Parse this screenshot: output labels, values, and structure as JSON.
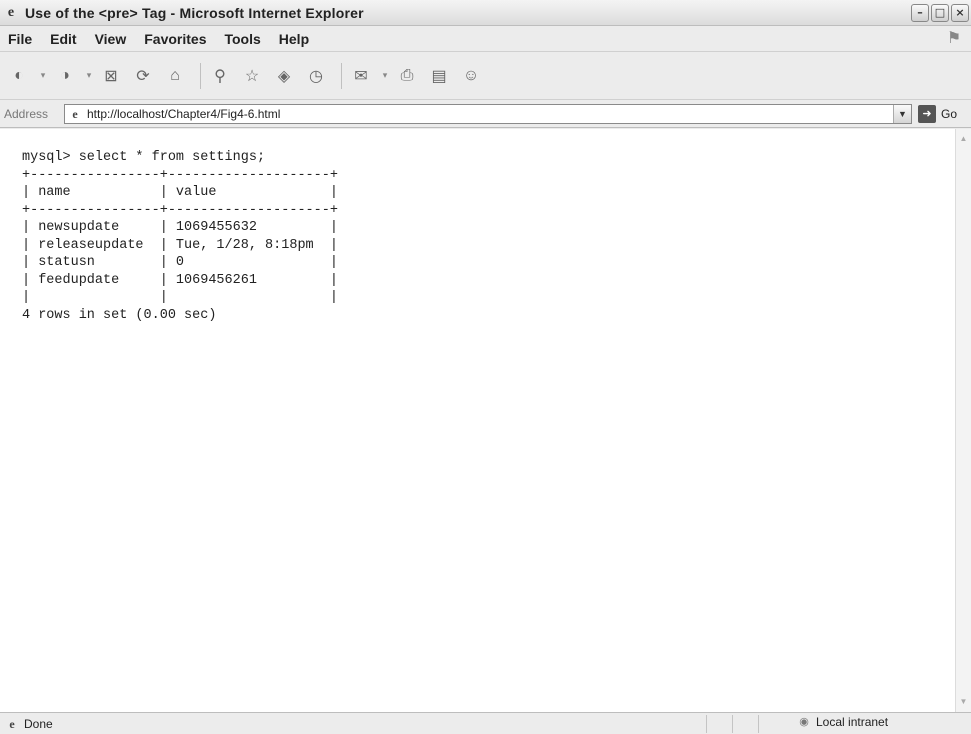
{
  "window": {
    "title": "Use of the <pre> Tag - Microsoft Internet Explorer",
    "controls": [
      "minimize-icon",
      "maximize-icon",
      "close-icon"
    ]
  },
  "menu": {
    "items": [
      "File",
      "Edit",
      "View",
      "Favorites",
      "Tools",
      "Help"
    ]
  },
  "toolbar": {
    "icons": [
      "back-icon",
      "forward-icon",
      "stop-icon",
      "refresh-icon",
      "home-icon",
      "search-icon",
      "favorites-icon",
      "media-icon",
      "history-icon",
      "mail-icon",
      "print-icon",
      "edit-icon",
      "messenger-icon"
    ]
  },
  "address": {
    "label": "Address",
    "url": "http://localhost/Chapter4/Fig4-6.html",
    "go_label": "Go"
  },
  "content": {
    "pre_text": "mysql> select * from settings;\n+----------------+--------------------+\n| name           | value              |\n+----------------+--------------------+\n| newsupdate     | 1069455632         |\n| releaseupdate  | Tue, 1/28, 8:18pm  |\n| statusn        | 0                  |\n| feedupdate     | 1069456261         |\n|                |                    |\n4 rows in set (0.00 sec)"
  },
  "status": {
    "text": "Done",
    "zone": "Local intranet"
  }
}
